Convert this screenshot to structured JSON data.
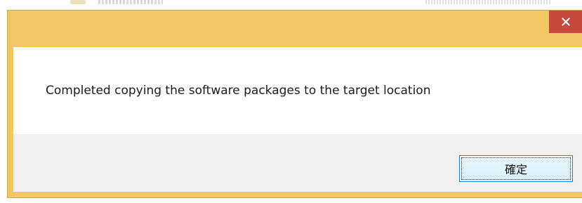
{
  "window": {
    "title": "",
    "frame_color": "#f2c867",
    "close_button_color": "#c74a3f",
    "close_icon": "close-icon"
  },
  "dialog": {
    "message": "Completed copying the software packages to the target location",
    "ok_label": "確定"
  }
}
